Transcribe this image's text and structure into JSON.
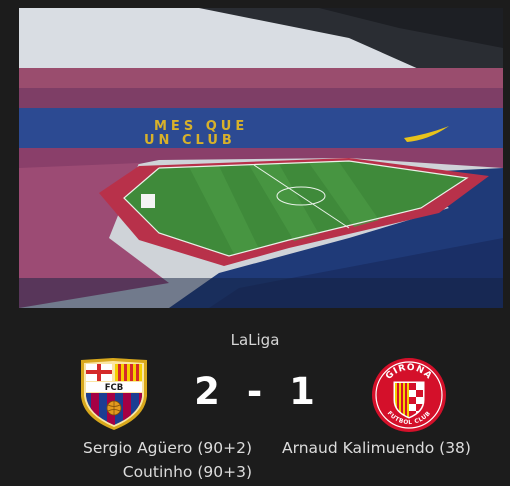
{
  "match": {
    "competition": "LaLiga",
    "home_score": "2",
    "separator": "-",
    "away_score": "1",
    "home_scorers": [
      "Sergio Agüero (90+2)",
      "Coutinho (90+3)"
    ],
    "away_scorers": [
      "Arnaud Kalimuendo (38)"
    ]
  },
  "stadium": {
    "banner_text": [
      "MES QUE",
      "UN CLUB"
    ]
  },
  "home_crest": {
    "icon": "fc-barcelona-crest-icon",
    "letters": "FCB"
  },
  "away_crest": {
    "icon": "girona-fc-crest-icon",
    "ring_top": "GIRONA",
    "ring_bottom": "FUTBOL CLUB"
  },
  "colors": {
    "background": "#1c1c1c",
    "score_text": "#ffffff",
    "label_text": "#dcdcdc",
    "barca_blue": "#1c3d92",
    "barca_garnet": "#a50044",
    "girona_red": "#d4102a"
  }
}
